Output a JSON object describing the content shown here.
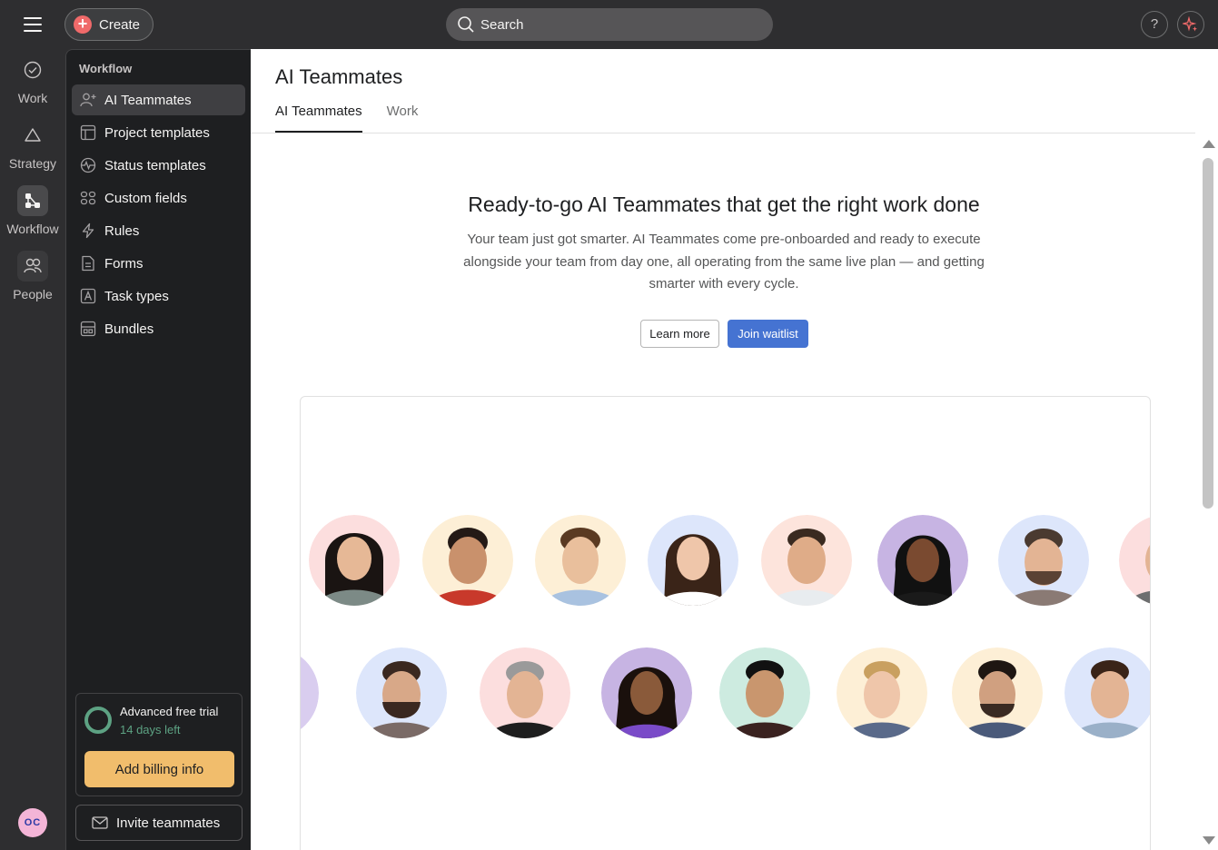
{
  "topbar": {
    "create_label": "Create",
    "search_placeholder": "Search",
    "help_label": "?"
  },
  "rail": {
    "items": [
      {
        "label": "Work",
        "icon": "check-circle-icon"
      },
      {
        "label": "Strategy",
        "icon": "triangle-icon"
      },
      {
        "label": "Workflow",
        "icon": "workflow-icon"
      },
      {
        "label": "People",
        "icon": "people-icon"
      }
    ],
    "active": "Workflow",
    "avatar_initials": "OC"
  },
  "sidebar": {
    "heading": "Workflow",
    "items": [
      {
        "label": "AI Teammates",
        "icon": "person-plus-icon"
      },
      {
        "label": "Project templates",
        "icon": "template-icon"
      },
      {
        "label": "Status templates",
        "icon": "status-pulse-icon"
      },
      {
        "label": "Custom fields",
        "icon": "custom-fields-icon"
      },
      {
        "label": "Rules",
        "icon": "lightning-icon"
      },
      {
        "label": "Forms",
        "icon": "form-icon"
      },
      {
        "label": "Task types",
        "icon": "task-type-icon"
      },
      {
        "label": "Bundles",
        "icon": "bundle-icon"
      }
    ],
    "trial": {
      "title": "Advanced free trial",
      "days_left": "14 days left",
      "billing_button": "Add billing info"
    },
    "invite_button": "Invite teammates"
  },
  "main": {
    "title": "AI Teammates",
    "tabs": [
      {
        "label": "AI Teammates",
        "active": true
      },
      {
        "label": "Work",
        "active": false
      }
    ],
    "hero": {
      "title": "Ready-to-go AI Teammates that get the right work done",
      "description": "Your team just got smarter. AI Teammates come pre-onboarded and ready to execute alongside your team from day one, all operating from the same live plan — and getting smarter with every cycle.",
      "learn_more": "Learn more",
      "join_waitlist": "Join waitlist"
    }
  },
  "colors": {
    "topbar_bg": "#2e2e30",
    "sidebar_bg": "#1e1f21",
    "create_accent": "#f06a6a",
    "primary_button": "#4573d2",
    "billing_button": "#f1bd6c",
    "trial_green": "#5da283"
  }
}
